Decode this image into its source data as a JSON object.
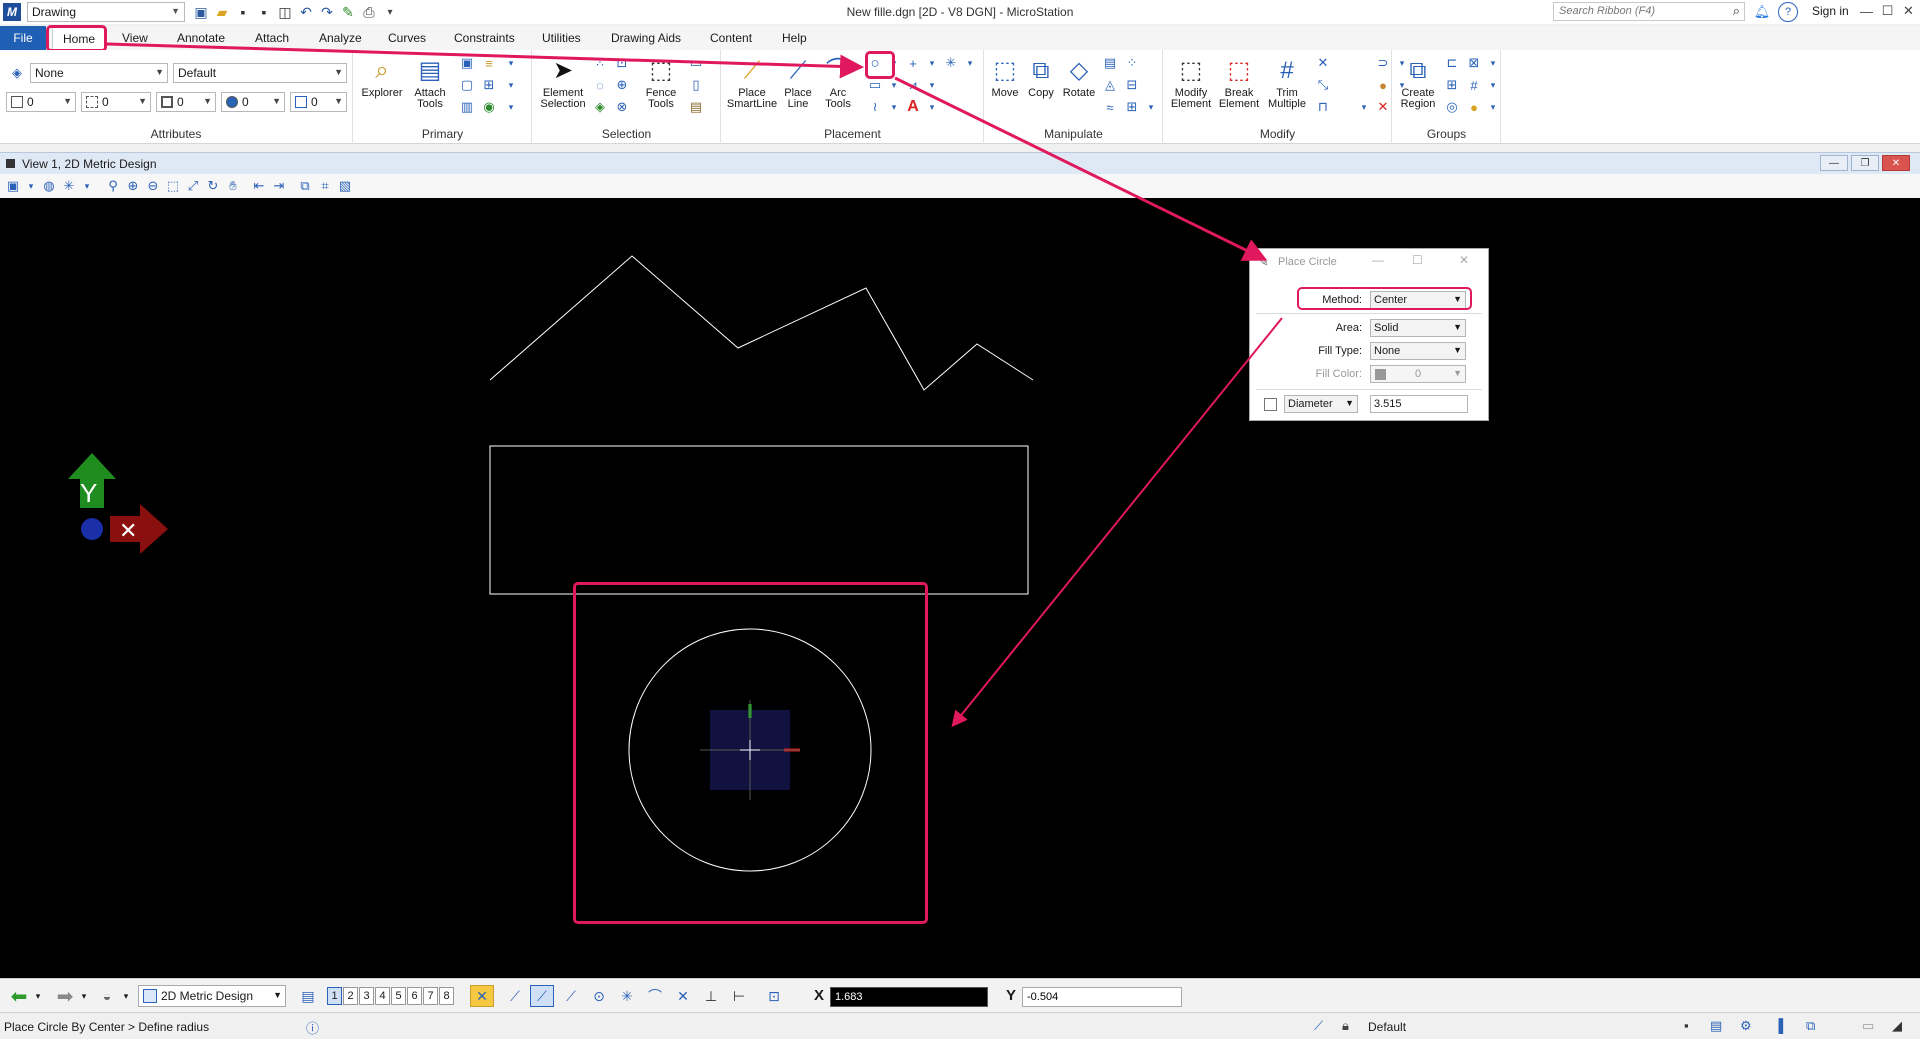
{
  "titlebar": {
    "workflow": "Drawing",
    "window_title": "New fille.dgn [2D - V8 DGN] - MicroStation",
    "search_placeholder": "Search Ribbon (F4)",
    "sign_in": "Sign in"
  },
  "tabs": [
    "File",
    "Home",
    "View",
    "Annotate",
    "Attach",
    "Analyze",
    "Curves",
    "Constraints",
    "Utilities",
    "Drawing Aids",
    "Content",
    "Help"
  ],
  "ribbon": {
    "attributes": {
      "label": "Attributes",
      "level": "None",
      "style": "Default",
      "color": "0",
      "weight": "0",
      "line_style": "0",
      "transparency": "0",
      "priority": "0"
    },
    "primary": {
      "label": "Primary",
      "explorer": "Explorer",
      "attach_tools": "Attach Tools"
    },
    "selection": {
      "label": "Selection",
      "element_selection": "Element Selection",
      "fence_tools": "Fence Tools"
    },
    "placement": {
      "label": "Placement",
      "place_smartline": "Place SmartLine",
      "place_line": "Place Line",
      "arc_tools": "Arc Tools"
    },
    "manipulate": {
      "label": "Manipulate",
      "move": "Move",
      "copy": "Copy",
      "rotate": "Rotate"
    },
    "modify": {
      "label": "Modify",
      "modify_element": "Modify Element",
      "break_element": "Break Element",
      "trim_multiple": "Trim Multiple"
    },
    "groups": {
      "label": "Groups",
      "create_region": "Create Region"
    }
  },
  "view": {
    "title": "View 1, 2D Metric Design"
  },
  "dialog": {
    "title": "Place Circle",
    "method_label": "Method:",
    "method_value": "Center",
    "area_label": "Area:",
    "area_value": "Solid",
    "fill_type_label": "Fill Type:",
    "fill_type_value": "None",
    "fill_color_label": "Fill Color:",
    "fill_color_value": "0",
    "dimension_option": "Diameter",
    "dimension_value": "3.515"
  },
  "bottombar": {
    "model": "2D Metric Design",
    "view_numbers": [
      "1",
      "2",
      "3",
      "4",
      "5",
      "6",
      "7",
      "8"
    ],
    "x_label": "X",
    "x_value": "1.683",
    "y_label": "Y",
    "y_value": "-0.504"
  },
  "status": {
    "message": "Place Circle By Center > Define radius",
    "active_level": "Default"
  },
  "colors": {
    "highlight": "#e0185e",
    "canvas": "#000000",
    "file_tab": "#1f5fb4",
    "axis_y": "#1e8c1e",
    "axis_x": "#8a1010"
  }
}
